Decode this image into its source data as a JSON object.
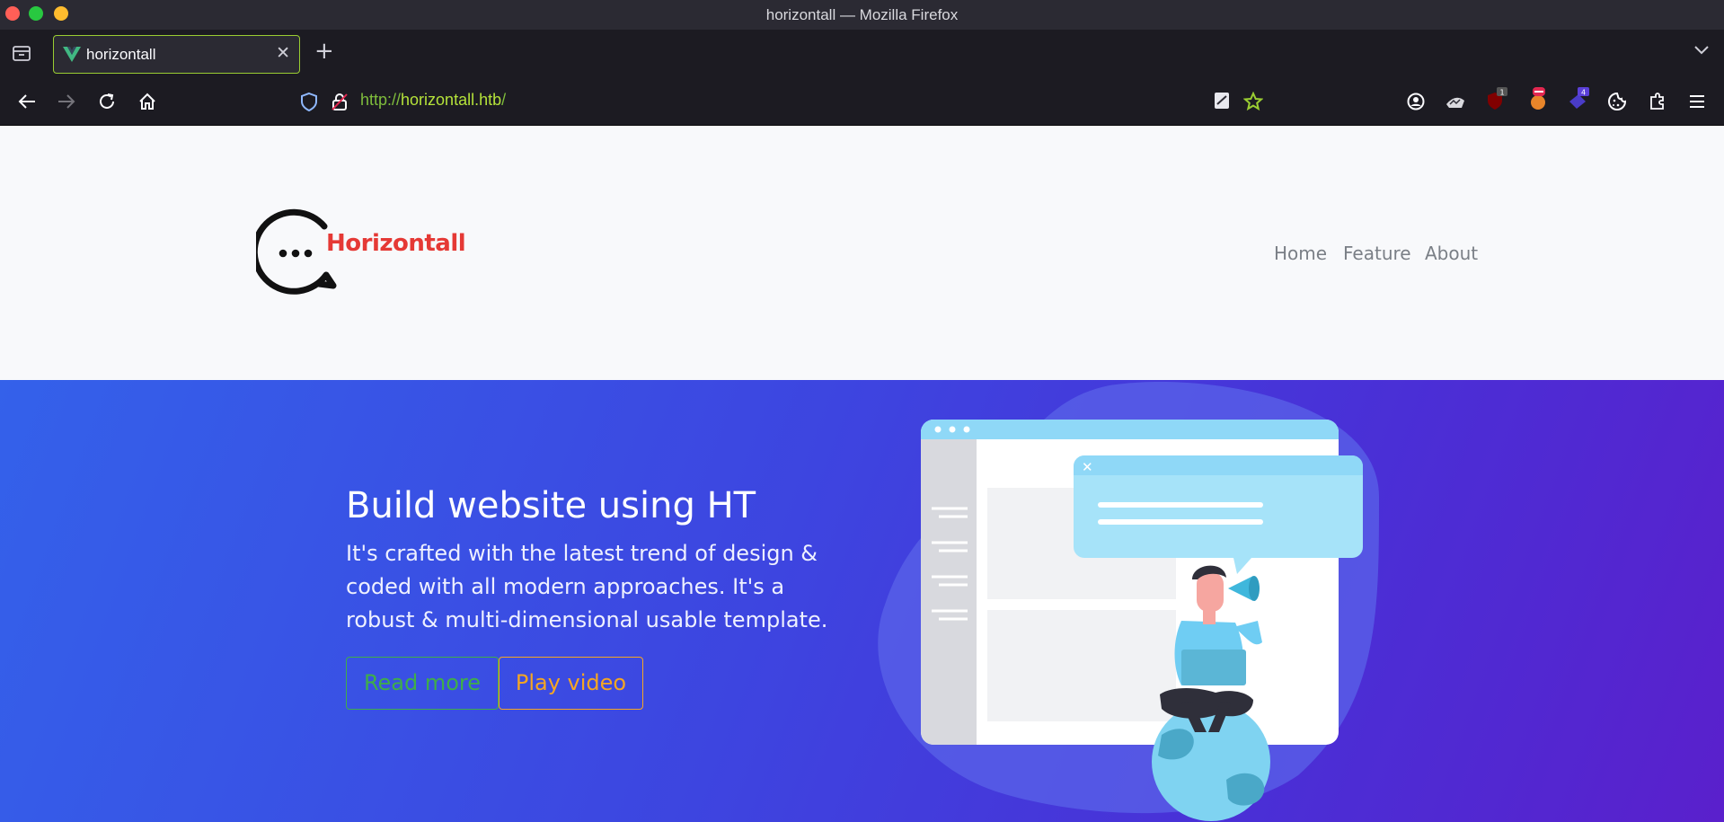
{
  "window": {
    "title": "horizontall — Mozilla Firefox"
  },
  "tabs": [
    {
      "label": "horizontall",
      "favicon": "vue-icon"
    }
  ],
  "toolbar": {
    "url_protocol": "http://",
    "url_host": "horizontall.htb",
    "url_path": "/",
    "extension_badges": {
      "ublock": "1",
      "extension_purple": "4"
    }
  },
  "site": {
    "brand": "Horizontall",
    "nav": [
      "Home",
      "Feature",
      "About"
    ],
    "hero": {
      "title": "Build website using HT",
      "lead": "It's crafted with the latest trend of design & coded with all modern approaches. It's a robust & multi-dimensional usable template.",
      "buttons": {
        "read_more": "Read more",
        "play_video": "Play video"
      }
    }
  },
  "colors": {
    "brand_red": "#e53935",
    "hero_start": "#3461ea",
    "hero_end": "#5a20cc",
    "read_more": "#3fae49",
    "play_video": "#f5a623",
    "tab_border": "#9acd32"
  }
}
